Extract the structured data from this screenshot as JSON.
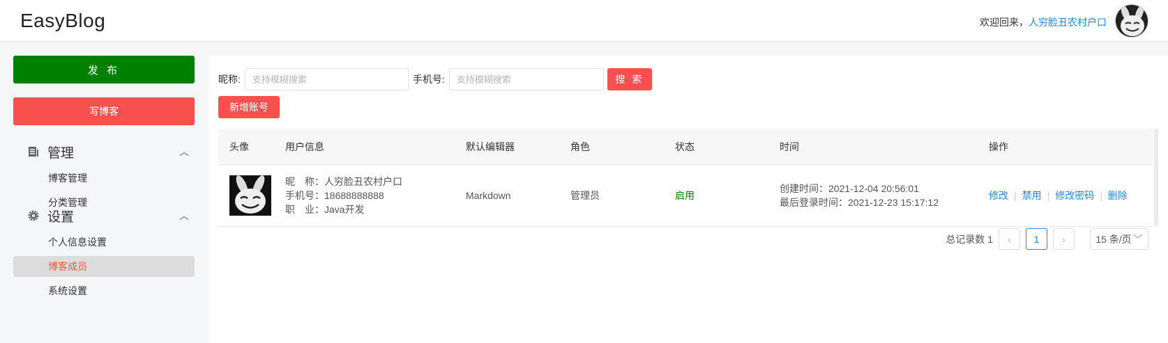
{
  "header": {
    "logo": "EasyBlog",
    "welcome_prefix": "欢迎回来，",
    "username": "人穷脸丑农村户口"
  },
  "sidebar": {
    "publish_label": "发 布",
    "write_label": "写博客",
    "groups": [
      {
        "title": "管理",
        "icon": "document-list-icon",
        "items": [
          "博客管理",
          "分类管理"
        ]
      },
      {
        "title": "设置",
        "icon": "gear-icon",
        "items": [
          "个人信息设置",
          "博客成员",
          "系统设置"
        ]
      }
    ],
    "active_item": "博客成员"
  },
  "search": {
    "nickname_label": "昵称:",
    "nickname_placeholder": "支持模糊搜索",
    "phone_label": "手机号:",
    "phone_placeholder": "支持模糊搜索",
    "search_label": "搜 索",
    "add_label": "新增账号"
  },
  "table": {
    "columns": [
      "头像",
      "用户信息",
      "默认编辑器",
      "角色",
      "状态",
      "时间",
      "操作"
    ],
    "rows": [
      {
        "nickname": "昵　称：人穷脸丑农村户口",
        "phone": "手机号：18688888888",
        "job": "职　业：Java开发",
        "editor": "Markdown",
        "role": "管理员",
        "status": "启用",
        "created": "创建时间：2021-12-04 20:56:01",
        "last_login": "最后登录时间：2021-12-23 15:17:12",
        "actions": [
          "修改",
          "禁用",
          "修改密码",
          "删除"
        ]
      }
    ]
  },
  "pagination": {
    "total_text": "总记录数 1",
    "current_page": "1",
    "page_size": "15 条/页"
  },
  "colors": {
    "green": "#008000",
    "red": "#f84f4f",
    "link": "#1e88e5",
    "active": "#f05b41"
  }
}
